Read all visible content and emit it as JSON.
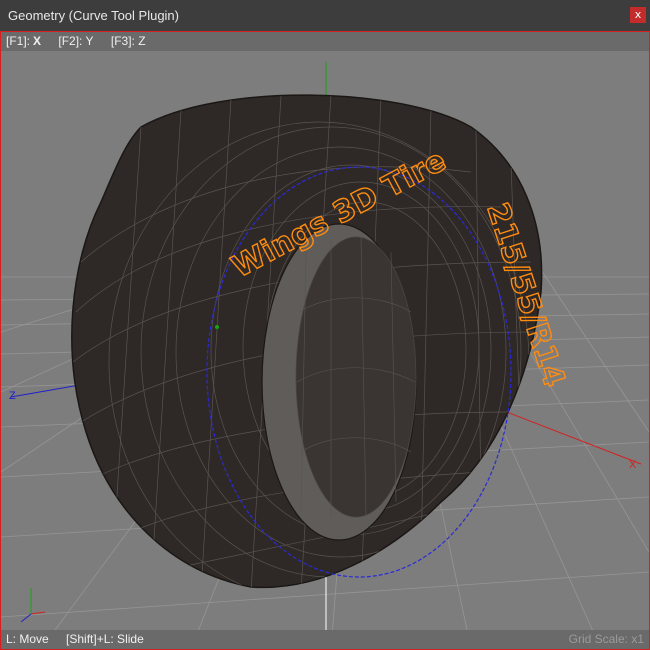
{
  "window": {
    "title": "Geometry (Curve Tool Plugin)",
    "close_glyph": "x"
  },
  "hints": {
    "f1_key": "[F1]:",
    "f1_val": "X",
    "f2": "[F2]: Y",
    "f3": "[F3]: Z"
  },
  "status": {
    "move": "L: Move",
    "slide": "[Shift]+L: Slide",
    "grid_scale": "Grid Scale: x1"
  },
  "scene": {
    "tire_text_top": "Wings 3D Tire",
    "tire_text_side": "215/55/R14",
    "axis_x_label": "X",
    "axis_z_label": "Z",
    "colors": {
      "background": "#7d7d7d",
      "tire": "#2e2926",
      "tire_text": "#ff8c10",
      "axis_x": "#d42020",
      "axis_y": "#16a316",
      "axis_z": "#2020c8",
      "curve": "#2a2ad6"
    }
  }
}
